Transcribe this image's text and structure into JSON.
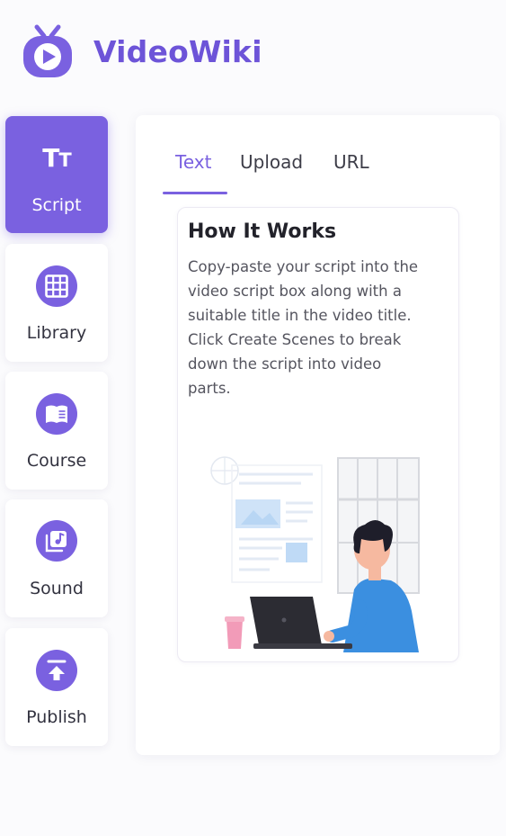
{
  "app": {
    "title": "VideoWiki",
    "logo_icon": "tv-play-icon",
    "brand_color": "#7a61e0"
  },
  "sidebar": {
    "items": [
      {
        "id": "script",
        "label": "Script",
        "icon": "text-size-icon",
        "active": true
      },
      {
        "id": "library",
        "label": "Library",
        "icon": "grid-icon",
        "active": false
      },
      {
        "id": "course",
        "label": "Course",
        "icon": "book-icon",
        "active": false
      },
      {
        "id": "sound",
        "label": "Sound",
        "icon": "music-icon",
        "active": false
      },
      {
        "id": "publish",
        "label": "Publish",
        "icon": "upload-icon",
        "active": false
      }
    ]
  },
  "main": {
    "tabs": [
      {
        "label": "Text",
        "active": true
      },
      {
        "label": "Upload",
        "active": false
      },
      {
        "label": "URL",
        "active": false
      }
    ],
    "how_it_works": {
      "title": "How It Works",
      "lines": [
        "Copy-paste your script into the",
        "video script box along with a",
        "suitable title in the video title.",
        "Click Create Scenes to break",
        "down the script into video",
        "parts."
      ],
      "illustration": "person-at-laptop-illustration"
    }
  }
}
